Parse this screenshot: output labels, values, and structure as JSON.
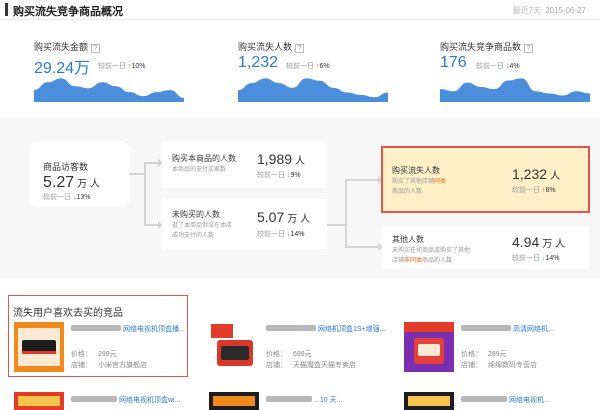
{
  "header": {
    "title": "购买流失竞争商品概况",
    "date_label": "最近7天",
    "date": "2015-06-27"
  },
  "kpis": [
    {
      "name": "购买流失金额",
      "value": "29.24万",
      "compare_label": "较前一日",
      "trend": "up",
      "pct": "10%"
    },
    {
      "name": "购买流失人数",
      "value": "1,232",
      "compare_label": "较前一日",
      "trend": "up",
      "pct": "6%"
    },
    {
      "name": "购买流失竞争商品数",
      "value": "176",
      "compare_label": "较前一日",
      "trend": "down",
      "pct": "4%"
    }
  ],
  "funnel": {
    "visitors": {
      "label": "商品访客数",
      "value": "5.27",
      "unit": "万 人",
      "compare_label": "较前一日",
      "trend": "down",
      "pct": "13%"
    },
    "bought": {
      "title": "购买本商品的人数",
      "desc": "本商品的支付买家数",
      "value": "1,989",
      "unit": "人",
      "compare_label": "较前一日",
      "trend": "down",
      "pct": "9%"
    },
    "not_bought": {
      "title": "未购买的人数",
      "desc_1": "逛了本商品但没在本店",
      "desc_2": "成功支付的人数",
      "value": "5.07",
      "unit": "万 人",
      "compare_label": "较前一日",
      "trend": "down",
      "pct": "14%"
    },
    "lost": {
      "title": "购买流失人数",
      "desc_1a": "购买了其他店铺",
      "desc_1b": "同类",
      "desc_2": "商品的人数",
      "value": "1,232",
      "unit": "人",
      "compare_label": "较前一日",
      "trend": "up",
      "pct": "6%"
    },
    "others": {
      "title": "其他人数",
      "desc_1": "未购买任何商品或购买了其他",
      "desc_2a": "店铺",
      "desc_2b": "非同类",
      "desc_2c": "商品的人数",
      "value": "4.94",
      "unit": "万 人",
      "compare_label": "较前一日",
      "trend": "down",
      "pct": "14%"
    }
  },
  "products_section": {
    "title": "流失用户喜欢去买的竞品",
    "price_label": "价格：",
    "store_label": "店铺：",
    "items": [
      {
        "name": "网络电视机顶盒播...",
        "price": "299元",
        "store": "小米官方旗舰店"
      },
      {
        "name": "网络机顶盒1S+增强...",
        "price": "699元",
        "store": "天猫魔盒天猫专卖店"
      },
      {
        "name": "高清网络机...",
        "price": "289元",
        "store": "绵绵数码专营店"
      }
    ],
    "row2": [
      {
        "name": "网络电视机顶盒wi..."
      },
      {
        "name": "...10 天..."
      },
      {
        "name": "网络电视机..."
      }
    ]
  },
  "colors": {
    "accent_blue": "#2a7ad6",
    "up_red": "#e0461e",
    "down_green": "#37a83b",
    "highlight_bg": "#fdf0c7",
    "highlight_border": "#e5544a"
  },
  "chart_data": [
    {
      "type": "area",
      "series": [
        {
          "values": [
            3,
            5,
            6,
            4,
            3.5,
            5,
            4,
            2.5,
            1.5,
            2.5,
            3,
            1
          ]
        }
      ]
    },
    {
      "type": "area",
      "series": [
        {
          "values": [
            2.5,
            4,
            5,
            4,
            3,
            5,
            4.5,
            3,
            2,
            1.5,
            1,
            2
          ]
        }
      ]
    },
    {
      "type": "area",
      "series": [
        {
          "values": [
            3,
            2.5,
            4.5,
            3.5,
            3,
            5,
            5.5,
            2.5,
            2,
            1.5,
            2.5,
            2
          ]
        }
      ]
    }
  ]
}
